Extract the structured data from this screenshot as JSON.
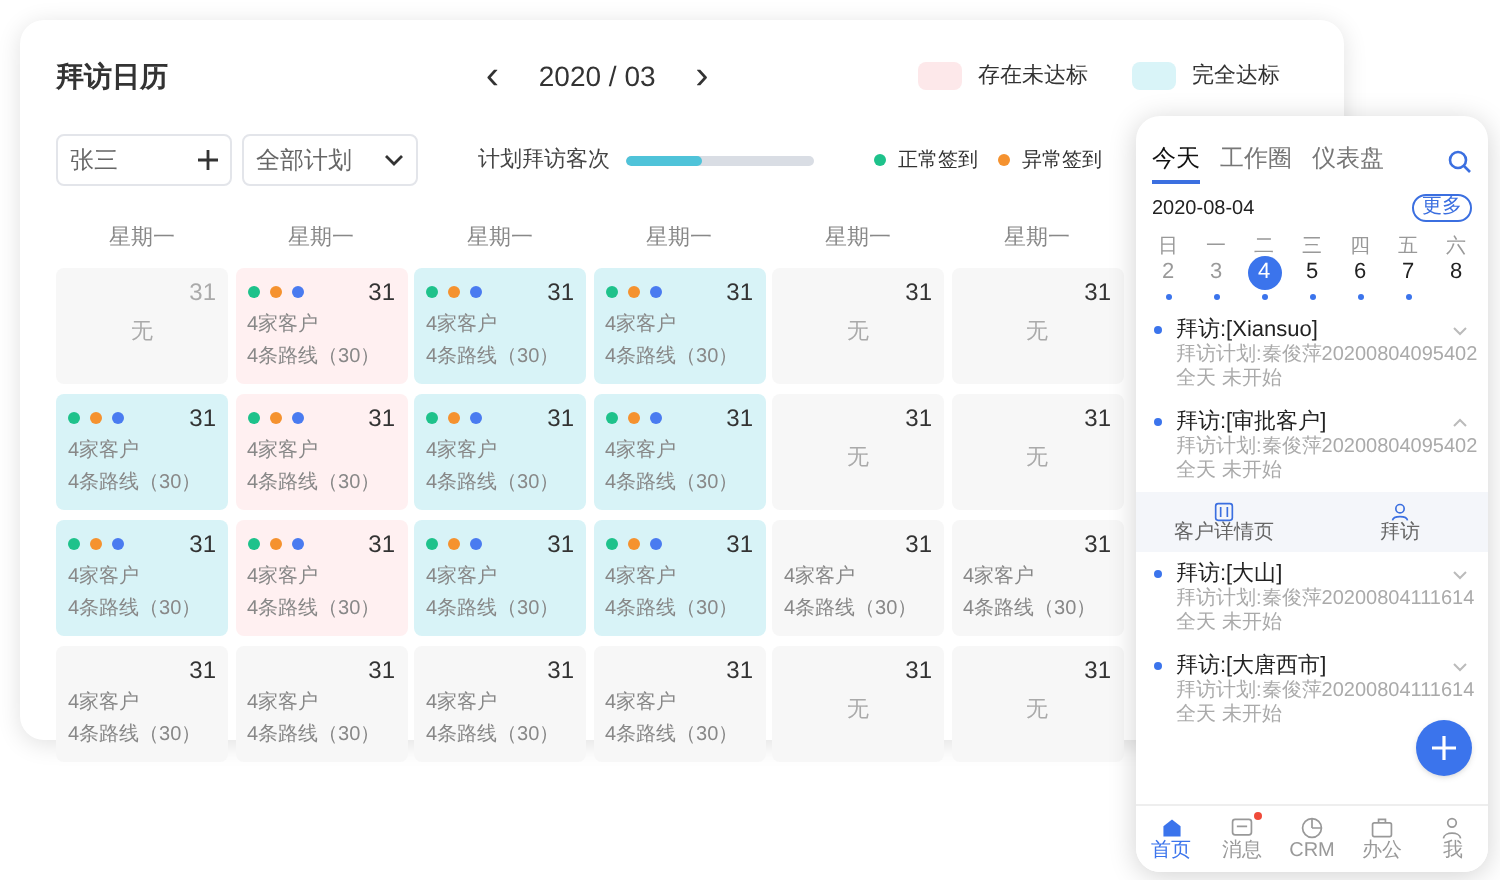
{
  "calendar": {
    "title": "拜访日历",
    "month": "2020 / 03",
    "prev": "‹",
    "next": "›",
    "status_legend": [
      {
        "label": "存在未达标",
        "kind": "pending"
      },
      {
        "label": "完全达标",
        "kind": "done"
      }
    ],
    "person_field": {
      "value": "张三"
    },
    "plan_select": {
      "value": "全部计划"
    },
    "progress": {
      "label": "计划拜访客次",
      "level": 0.4
    },
    "dot_legend": [
      {
        "label": "正常签到",
        "color": "#1ec28b"
      },
      {
        "label": "异常签到",
        "color": "#f5922f"
      }
    ],
    "weekdays": [
      "星期一",
      "星期一",
      "星期一",
      "星期一",
      "星期一",
      "星期一"
    ],
    "cells": [
      {
        "day": "31",
        "kind": "none",
        "muted": true,
        "dots": false,
        "empty_text": "无"
      },
      {
        "day": "31",
        "kind": "pending",
        "muted": false,
        "dots": true,
        "lines": [
          "4家客户",
          "4条路线（30）"
        ]
      },
      {
        "day": "31",
        "kind": "done",
        "muted": false,
        "dots": true,
        "lines": [
          "4家客户",
          "4条路线（30）"
        ]
      },
      {
        "day": "31",
        "kind": "done",
        "muted": false,
        "dots": true,
        "lines": [
          "4家客户",
          "4条路线（30）"
        ]
      },
      {
        "day": "31",
        "kind": "none",
        "muted": false,
        "dots": false,
        "empty_text": "无"
      },
      {
        "day": "31",
        "kind": "none",
        "muted": false,
        "dots": false,
        "empty_text": "无"
      },
      {
        "day": "31",
        "kind": "done",
        "muted": false,
        "dots": true,
        "lines": [
          "4家客户",
          "4条路线（30）"
        ]
      },
      {
        "day": "31",
        "kind": "pending",
        "muted": false,
        "dots": true,
        "lines": [
          "4家客户",
          "4条路线（30）"
        ]
      },
      {
        "day": "31",
        "kind": "done",
        "muted": false,
        "dots": true,
        "lines": [
          "4家客户",
          "4条路线（30）"
        ]
      },
      {
        "day": "31",
        "kind": "done",
        "muted": false,
        "dots": true,
        "lines": [
          "4家客户",
          "4条路线（30）"
        ]
      },
      {
        "day": "31",
        "kind": "none",
        "muted": false,
        "dots": false,
        "empty_text": "无"
      },
      {
        "day": "31",
        "kind": "none",
        "muted": false,
        "dots": false,
        "empty_text": "无"
      },
      {
        "day": "31",
        "kind": "done",
        "muted": false,
        "dots": true,
        "lines": [
          "4家客户",
          "4条路线（30）"
        ]
      },
      {
        "day": "31",
        "kind": "pending",
        "muted": false,
        "dots": true,
        "lines": [
          "4家客户",
          "4条路线（30）"
        ]
      },
      {
        "day": "31",
        "kind": "done",
        "muted": false,
        "dots": true,
        "lines": [
          "4家客户",
          "4条路线（30）"
        ]
      },
      {
        "day": "31",
        "kind": "done",
        "muted": false,
        "dots": true,
        "lines": [
          "4家客户",
          "4条路线（30）"
        ]
      },
      {
        "day": "31",
        "kind": "none",
        "muted": false,
        "dots": false,
        "lines": [
          "4家客户",
          "4条路线（30）"
        ]
      },
      {
        "day": "31",
        "kind": "none",
        "muted": false,
        "dots": false,
        "lines": [
          "4家客户",
          "4条路线（30）"
        ]
      },
      {
        "day": "31",
        "kind": "none",
        "muted": false,
        "dots": false,
        "lines": [
          "4家客户",
          "4条路线（30）"
        ]
      },
      {
        "day": "31",
        "kind": "none",
        "muted": false,
        "dots": false,
        "lines": [
          "4家客户",
          "4条路线（30）"
        ]
      },
      {
        "day": "31",
        "kind": "none",
        "muted": false,
        "dots": false,
        "lines": [
          "4家客户",
          "4条路线（30）"
        ]
      },
      {
        "day": "31",
        "kind": "none",
        "muted": false,
        "dots": false,
        "lines": [
          "4家客户",
          "4条路线（30）"
        ]
      },
      {
        "day": "31",
        "kind": "none",
        "muted": false,
        "dots": false,
        "empty_text": "无"
      },
      {
        "day": "31",
        "kind": "none",
        "muted": false,
        "dots": false,
        "empty_text": "无"
      }
    ]
  },
  "phone": {
    "tabs": [
      {
        "label": "今天",
        "selected": true
      },
      {
        "label": "工作圈",
        "selected": false
      },
      {
        "label": "仪表盘",
        "selected": false
      }
    ],
    "date": "2020-08-04",
    "more_button": "更多",
    "week_labels": [
      "日",
      "一",
      "二",
      "三",
      "四",
      "五",
      "六"
    ],
    "days": [
      {
        "label": "2",
        "selected": false,
        "has_events": true,
        "past": true
      },
      {
        "label": "3",
        "selected": false,
        "has_events": true,
        "past": true
      },
      {
        "label": "4",
        "selected": true,
        "has_events": true,
        "past": false
      },
      {
        "label": "5",
        "selected": false,
        "has_events": true,
        "past": false
      },
      {
        "label": "6",
        "selected": false,
        "has_events": true,
        "past": false
      },
      {
        "label": "7",
        "selected": false,
        "has_events": true,
        "past": false
      },
      {
        "label": "8",
        "selected": false,
        "has_events": false,
        "past": false
      }
    ],
    "visits": [
      {
        "title": "拜访:[Xiansuo]",
        "plan": "拜访计划:秦俊萍20200804095402",
        "status": "全天 未开始",
        "expanded": false
      },
      {
        "title": "拜访:[审批客户]",
        "plan": "拜访计划:秦俊萍20200804095402",
        "status": "全天 未开始",
        "expanded": true,
        "actions": [
          {
            "label": "客户详情页",
            "kind": "detail"
          },
          {
            "label": "拜访",
            "kind": "visit"
          }
        ]
      },
      {
        "title": "拜访:[大山]",
        "plan": "拜访计划:秦俊萍20200804111614",
        "status": "全天 未开始",
        "expanded": false
      },
      {
        "title": "拜访:[大唐西市]",
        "plan": "拜访计划:秦俊萍20200804111614",
        "status": "全天 未开始",
        "expanded": false
      }
    ],
    "nav": [
      {
        "label": "首页",
        "kind": "home",
        "selected": true,
        "badge": false
      },
      {
        "label": "消息",
        "kind": "message",
        "selected": false,
        "badge": true
      },
      {
        "label": "CRM",
        "kind": "chart",
        "selected": false,
        "badge": false
      },
      {
        "label": "办公",
        "kind": "briefcase",
        "selected": false,
        "badge": false
      },
      {
        "label": "我",
        "kind": "person",
        "selected": false,
        "badge": false
      }
    ]
  }
}
